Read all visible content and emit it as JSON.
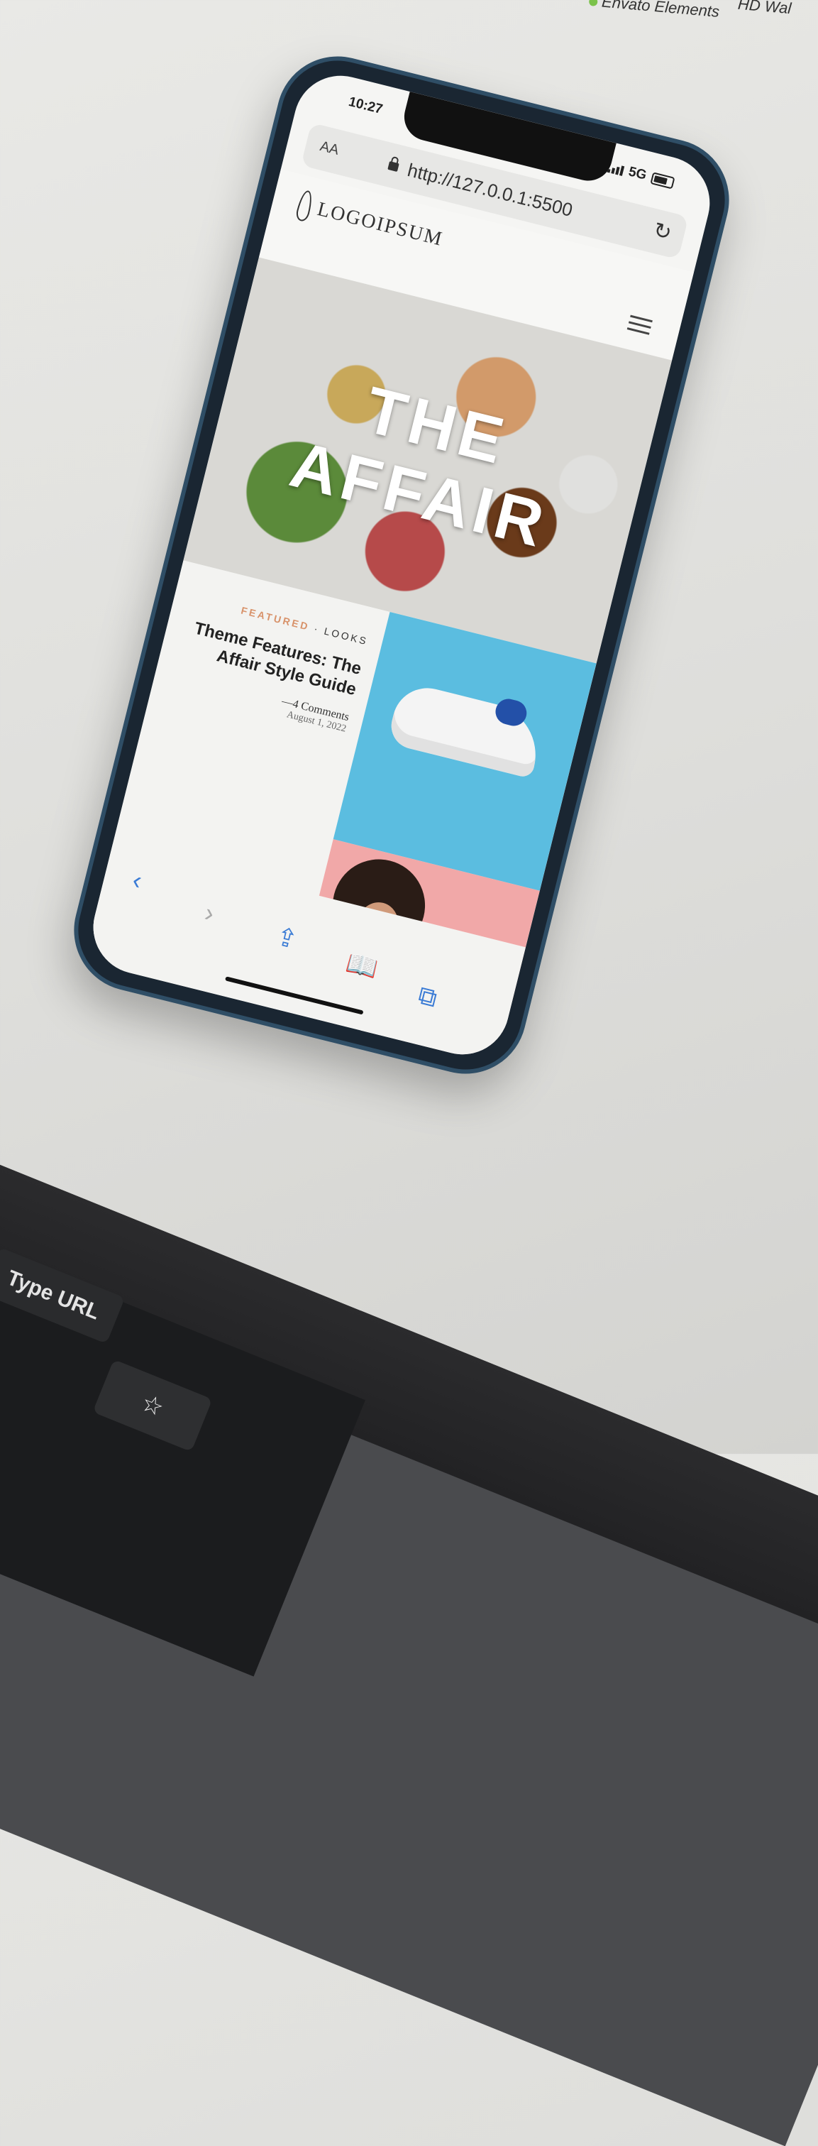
{
  "desktop": {
    "top_items": [
      "Envato Elements",
      "HD Wal"
    ],
    "key_type_url": "Type URL",
    "key_star": "☆"
  },
  "phone": {
    "status": {
      "time": "10:27",
      "network": "5G"
    },
    "browser": {
      "text_size_label": "AA",
      "url": "http://127.0.0.1:5500"
    },
    "site": {
      "logo_text": "LOGOIPSUM",
      "hero_title_line1": "THE",
      "hero_title_line2": "AFFAIR",
      "post": {
        "category_featured": "FEATURED",
        "category_separator": " · ",
        "category_looks": "LOOKS",
        "title": "Theme Features: The Affair Style Guide",
        "comments": "—4 Comments",
        "date": "August 1, 2022"
      }
    },
    "toolbar": {
      "back_icon": "‹",
      "forward_icon": "›",
      "share_icon": "⇪",
      "bookmarks_icon": "📖",
      "tabs_icon": "⧉"
    }
  },
  "colors": {
    "phone_frame": "#2f4e66",
    "accent_blue": "#3a7bd5",
    "featured": "#d8926a",
    "shoe_bg": "#5bbde0",
    "pink_bg": "#f1a8a8"
  }
}
